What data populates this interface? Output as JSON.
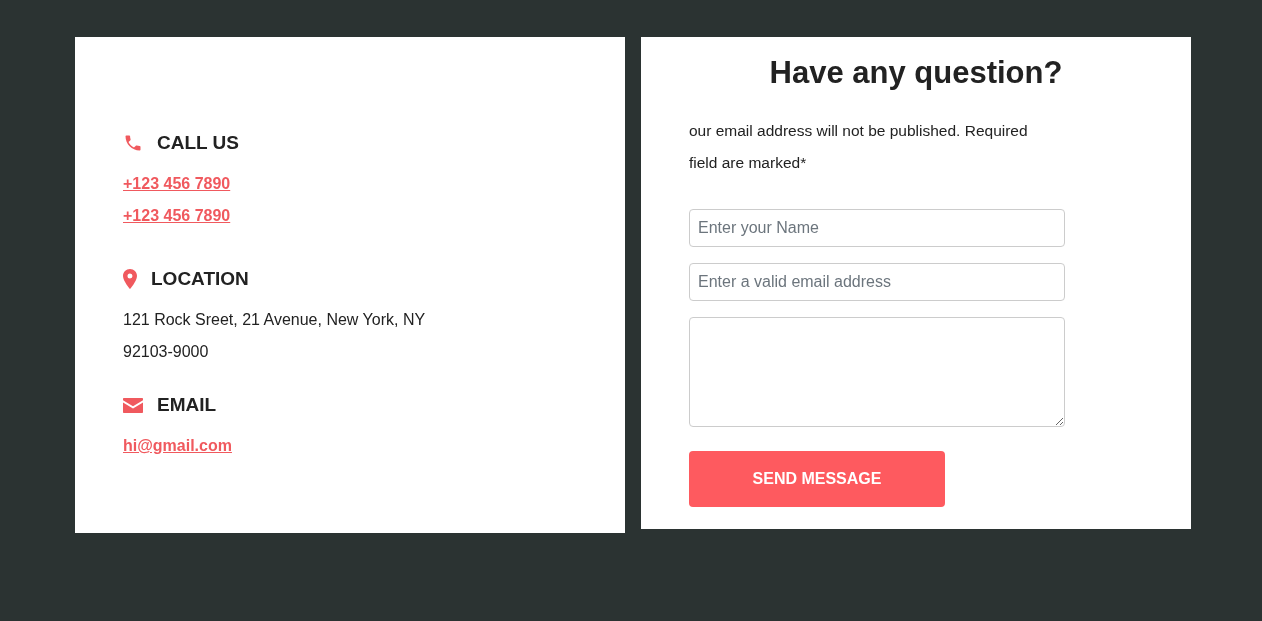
{
  "contact_info": [
    {
      "kind": "phone",
      "title": "CALL US",
      "links": [
        "+123 456 7890",
        "+123 456 7890"
      ]
    },
    {
      "kind": "location",
      "title": "LOCATION",
      "text": "121 Rock Sreet, 21 Avenue, New York, NY 92103-9000"
    },
    {
      "kind": "email",
      "title": "EMAIL",
      "links": [
        "hi@gmail.com"
      ]
    }
  ],
  "form": {
    "title": "Have any question?",
    "note": "our email address will not be published. Required field are marked*",
    "fields": [
      {
        "kind": "input",
        "placeholder": "Enter your Name"
      },
      {
        "kind": "input",
        "placeholder": "Enter a valid email address"
      },
      {
        "kind": "textarea"
      }
    ],
    "button": "SEND MESSAGE"
  }
}
